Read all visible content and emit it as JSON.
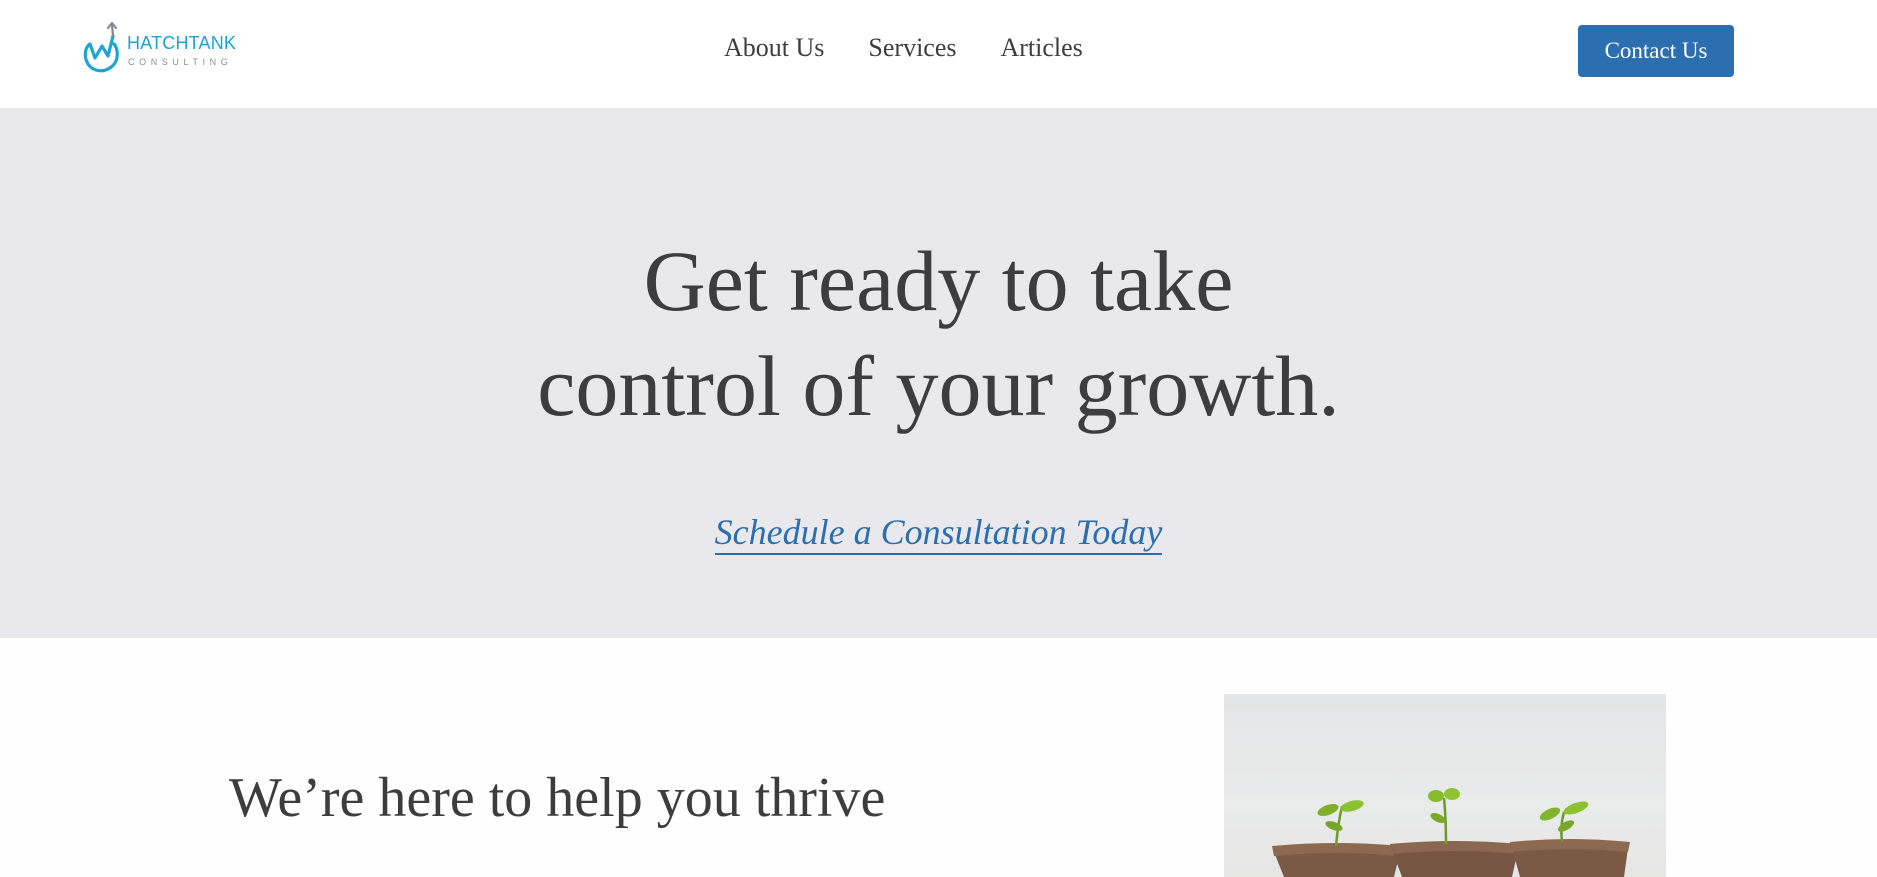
{
  "brand": {
    "name": "HATCHTANK",
    "tagline": "CONSULTING",
    "colors": {
      "primary": "#2b6fb0",
      "logo": "#1fa3d6",
      "hero_bg": "#e9e9ed",
      "text": "#3d3d3f"
    }
  },
  "nav": {
    "items": [
      {
        "label": "About Us"
      },
      {
        "label": "Services"
      },
      {
        "label": "Articles"
      }
    ],
    "contact_label": "Contact Us"
  },
  "hero": {
    "title_line1": "Get ready to take",
    "title_line2": "control of your growth.",
    "cta_label": "Schedule a Consultation Today"
  },
  "intro": {
    "heading": "We’re here to help you thrive",
    "image_icon": "seedlings-in-pots-photo"
  }
}
